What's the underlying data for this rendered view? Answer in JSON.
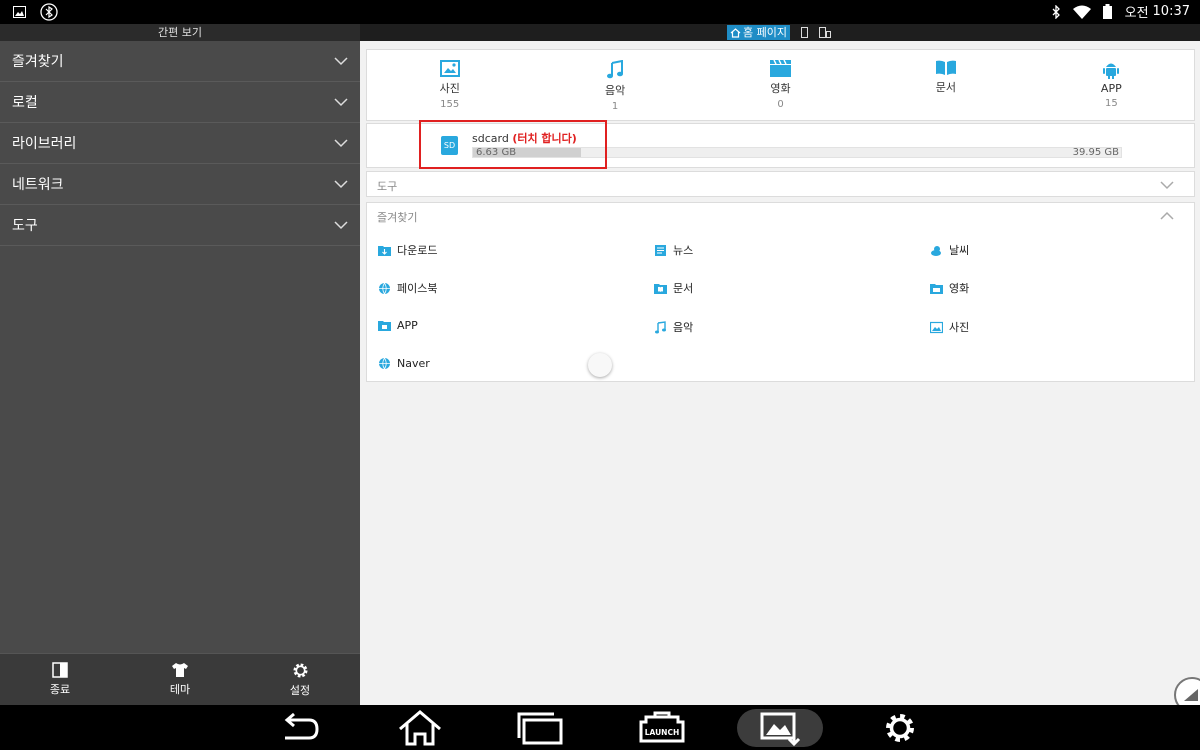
{
  "status_bar": {
    "time_prefix": "오전",
    "time": "10:37",
    "icons": [
      "gallery-icon",
      "bluetooth-off-icon",
      "bluetooth-icon",
      "wifi-icon",
      "battery-icon"
    ]
  },
  "sidebar": {
    "header": "간편 보기",
    "items": [
      {
        "label": "즐겨찾기"
      },
      {
        "label": "로컬"
      },
      {
        "label": "라이브러리"
      },
      {
        "label": "네트워크"
      },
      {
        "label": "도구"
      }
    ],
    "bottom": [
      {
        "label": "종료",
        "icon": "exit-icon"
      },
      {
        "label": "테마",
        "icon": "shirt-icon"
      },
      {
        "label": "설정",
        "icon": "gear-icon"
      }
    ]
  },
  "main": {
    "home_tab": "홈 페이지",
    "categories": [
      {
        "label": "사진",
        "count": "155",
        "icon": "image-icon"
      },
      {
        "label": "음악",
        "count": "1",
        "icon": "music-icon"
      },
      {
        "label": "영화",
        "count": "0",
        "icon": "movie-icon"
      },
      {
        "label": "문서",
        "count": "",
        "icon": "book-icon"
      },
      {
        "label": "APP",
        "count": "15",
        "icon": "android-icon"
      }
    ],
    "storage": {
      "name": "sdcard",
      "touch_hint": "(터치 합니다)",
      "icon_text": "SD",
      "used": "6.63 GB",
      "total": "39.95 GB",
      "used_fraction": 0.166
    },
    "tools_section": "도구",
    "favorites_section": "즐겨찾기",
    "favorites": [
      {
        "label": "다운로드",
        "icon": "download-folder-icon"
      },
      {
        "label": "뉴스",
        "icon": "news-icon"
      },
      {
        "label": "날씨",
        "icon": "weather-icon"
      },
      {
        "label": "페이스북",
        "icon": "globe-icon"
      },
      {
        "label": "문서",
        "icon": "document-icon"
      },
      {
        "label": "영화",
        "icon": "movie-icon"
      },
      {
        "label": "APP",
        "icon": "android-icon"
      },
      {
        "label": "음악",
        "icon": "music-icon"
      },
      {
        "label": "사진",
        "icon": "image-icon"
      },
      {
        "label": "Naver",
        "icon": "globe-icon"
      }
    ]
  },
  "nav_bar": {
    "buttons": [
      "back-icon",
      "home-icon",
      "recents-icon",
      "launch-icon",
      "gallery-icon",
      "gear-icon"
    ],
    "launch_text": "LAUNCH"
  },
  "colors": {
    "accent": "#29a8de",
    "highlight": "#e02020",
    "sidebar_bg": "#4a4a4a"
  }
}
